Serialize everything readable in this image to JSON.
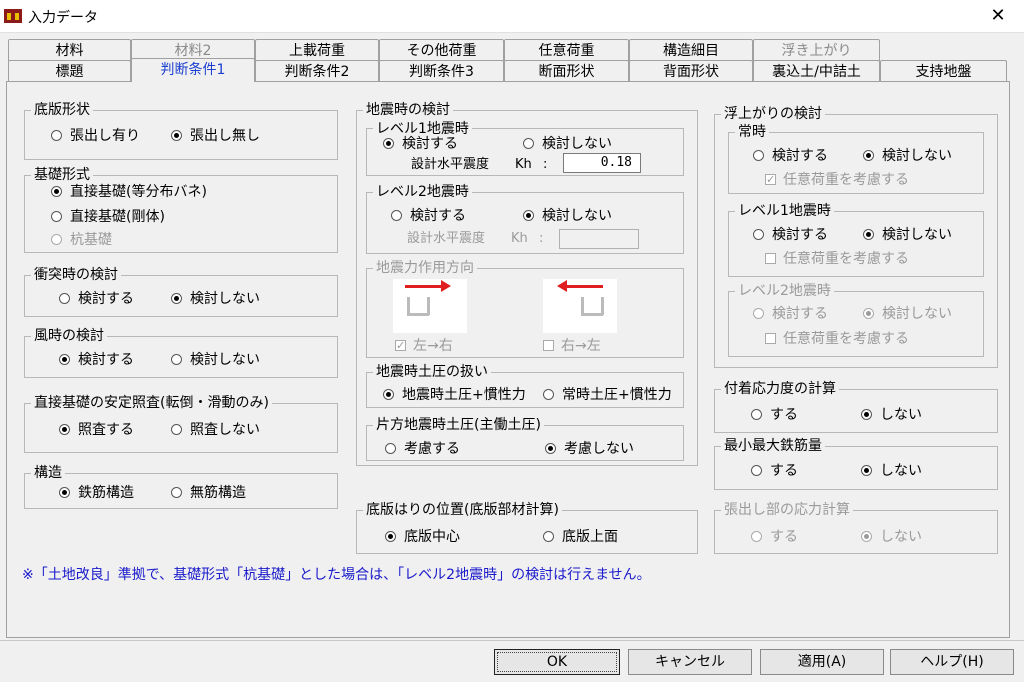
{
  "window": {
    "title": "入力データ",
    "close": "✕"
  },
  "tabs_row1": [
    "材料",
    "材料2",
    "上載荷重",
    "その他荷重",
    "任意荷重",
    "構造細目",
    "浮き上がり"
  ],
  "tabs_row2": [
    "標題",
    "判断条件1",
    "判断条件2",
    "判断条件3",
    "断面形状",
    "背面形状",
    "裏込土/中詰土",
    "支持地盤"
  ],
  "left": {
    "bottom_slab": {
      "title": "底版形状",
      "opt1": "張出し有り",
      "opt2": "張出し無し"
    },
    "foundation": {
      "title": "基礎形式",
      "opt1": "直接基礎(等分布バネ)",
      "opt2": "直接基礎(剛体)",
      "opt3": "杭基礎"
    },
    "collision": {
      "title": "衝突時の検討",
      "opt1": "検討する",
      "opt2": "検討しない"
    },
    "wind": {
      "title": "風時の検討",
      "opt1": "検討する",
      "opt2": "検討しない"
    },
    "stability": {
      "title": "直接基礎の安定照査(転倒・滑動のみ)",
      "opt1": "照査する",
      "opt2": "照査しない"
    },
    "structure": {
      "title": "構造",
      "opt1": "鉄筋構造",
      "opt2": "無筋構造"
    }
  },
  "middle": {
    "seismic": {
      "title": "地震時の検討",
      "level1": {
        "title": "レベル1地震時",
        "opt1": "検討する",
        "opt2": "検討しない",
        "coef_label": "設計水平震度",
        "kh": "Kh",
        "colon": ":",
        "value": "0.18"
      },
      "level2": {
        "title": "レベル2地震時",
        "opt1": "検討する",
        "opt2": "検討しない",
        "coef_label": "設計水平震度",
        "kh": "Kh",
        "colon": ":",
        "value": ""
      },
      "direction": {
        "title": "地震力作用方向",
        "cb1": "左→右",
        "cb2": "右→左"
      },
      "earth_pressure": {
        "title": "地震時土圧の扱い",
        "opt1": "地震時土圧+慣性力",
        "opt2": "常時土圧+慣性力"
      },
      "one_side": {
        "title": "片方地震時土圧(主働土圧)",
        "opt1": "考慮する",
        "opt2": "考慮しない"
      }
    },
    "beam_position": {
      "title": "底版はりの位置(底版部材計算)",
      "opt1": "底版中心",
      "opt2": "底版上面"
    }
  },
  "right": {
    "uplift": {
      "title": "浮上がりの検討",
      "normal": {
        "title": "常時",
        "opt1": "検討する",
        "opt2": "検討しない",
        "check": "任意荷重を考慮する"
      },
      "level1": {
        "title": "レベル1地震時",
        "opt1": "検討する",
        "opt2": "検討しない",
        "check": "任意荷重を考慮する"
      },
      "level2": {
        "title": "レベル2地震時",
        "opt1": "検討する",
        "opt2": "検討しない",
        "check": "任意荷重を考慮する"
      }
    },
    "bond": {
      "title": "付着応力度の計算",
      "opt1": "する",
      "opt2": "しない"
    },
    "rebar": {
      "title": "最小最大鉄筋量",
      "opt1": "する",
      "opt2": "しない"
    },
    "overhang": {
      "title": "張出し部の応力計算",
      "opt1": "する",
      "opt2": "しない"
    }
  },
  "note": "※「土地改良」準拠で、基礎形式「杭基礎」とした場合は、「レベル2地震時」の検討は行えません。",
  "buttons": {
    "ok": "OK",
    "cancel": "キャンセル",
    "apply": "適用(A)",
    "help": "ヘルプ(H)"
  },
  "colors": {
    "active_tab": "#1a3fd0",
    "note": "#1a1acc",
    "arrow": "#e02020"
  }
}
